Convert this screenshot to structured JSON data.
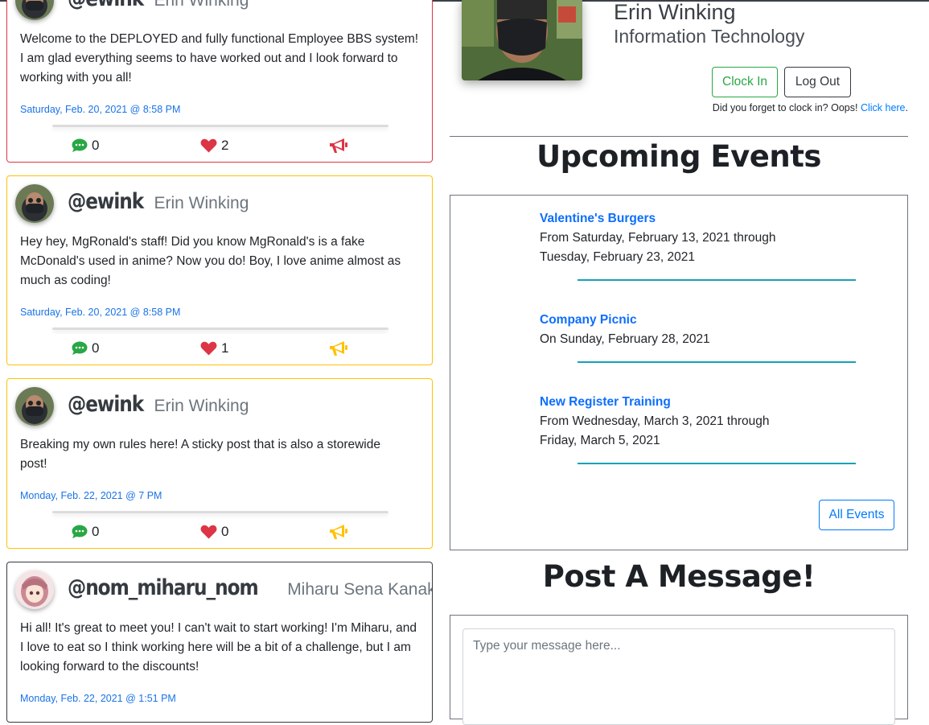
{
  "posts": [
    {
      "handle": "@ewink",
      "name": "Erin Winking",
      "text": "Welcome to the DEPLOYED and fully functional Employee BBS system! I am glad everything seems to have worked out and I look forward to working with you all!",
      "date": "Saturday, Feb. 20, 2021 @ 8:58 PM",
      "comments": "0",
      "likes": "2",
      "style": "danger",
      "megaphone_color": "#dc3545"
    },
    {
      "handle": "@ewink",
      "name": "Erin Winking",
      "text": "Hey hey, MgRonald's staff! Did you know MgRonald's is a fake McDonald's used in anime? Now you do! Boy, I love anime almost as much as coding!",
      "date": "Saturday, Feb. 20, 2021 @ 8:58 PM",
      "comments": "0",
      "likes": "1",
      "style": "warning",
      "megaphone_color": "#ffc107"
    },
    {
      "handle": "@ewink",
      "name": "Erin Winking",
      "text": "Breaking my own rules here! A sticky post that is also a storewide post!",
      "date": "Monday, Feb. 22, 2021 @ 7 PM",
      "comments": "0",
      "likes": "0",
      "style": "warning",
      "megaphone_color": "#ffc107"
    },
    {
      "handle": "@nom_miharu_nom",
      "name": "Miharu Sena Kanaka",
      "text": "Hi all! It's great to meet you! I can't wait to start working! I'm Miharu, and I love to eat so I think working here will be a bit of a challenge, but I am looking forward to the discounts!",
      "date": "Monday, Feb. 22, 2021 @ 1:51 PM",
      "style": "dark"
    }
  ],
  "profile": {
    "name": "Erin Winking",
    "department": "Information Technology",
    "clock_in_label": "Clock In",
    "log_out_label": "Log Out",
    "forgot_text": "Did you forget to clock in? Oops!",
    "forgot_link": "Click here",
    "forgot_tail": "."
  },
  "events_section": {
    "title": "Upcoming Events",
    "events": [
      {
        "title": "Valentine's Burgers",
        "line1": "From Saturday, February 13, 2021 through",
        "line2": "Tuesday, February 23, 2021"
      },
      {
        "title": "Company Picnic",
        "line1": "On Sunday, February 28, 2021",
        "line2": ""
      },
      {
        "title": "New Register Training",
        "line1": "From Wednesday, March 3, 2021 through",
        "line2": "Friday, March 5, 2021"
      }
    ],
    "all_events_label": "All Events"
  },
  "message_section": {
    "title": "Post A Message!",
    "placeholder": "Type your message here..."
  },
  "colors": {
    "comment": "#28a745",
    "heart": "#dc3545",
    "link": "#007bff",
    "event_divider": "#17a2b8"
  },
  "icons": [
    "comment-icon",
    "heart-icon",
    "megaphone-icon"
  ]
}
